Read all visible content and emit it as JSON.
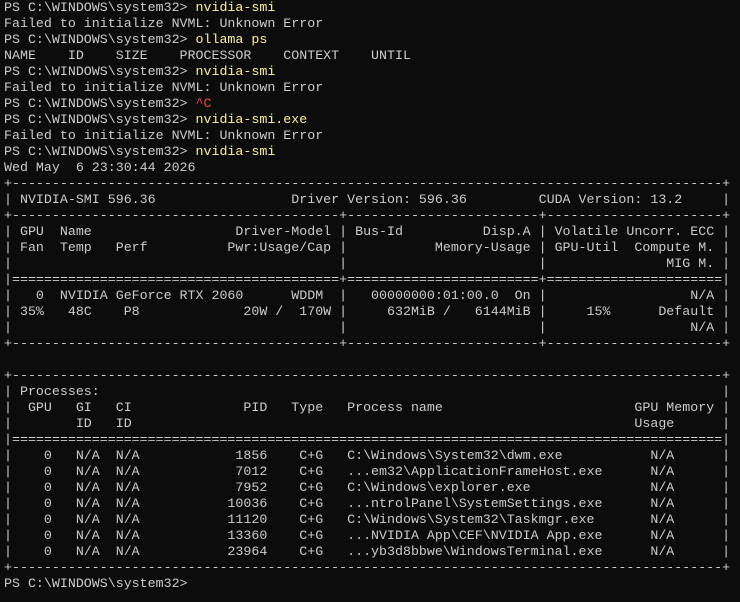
{
  "colors": {
    "background": "#0c0c0c",
    "text": "#cccccc",
    "command": "#f9f1a5",
    "interrupt": "#e74856"
  },
  "prompt": "PS C:\\WINDOWS\\system32> ",
  "history": [
    {
      "cmd": "nvidia-smi"
    },
    {
      "out": "Failed to initialize NVML: Unknown Error"
    },
    {
      "cmd": "ollama ps"
    },
    {
      "out": "NAME    ID    SIZE    PROCESSOR    CONTEXT    UNTIL"
    },
    {
      "cmd": "nvidia-smi"
    },
    {
      "out": "Failed to initialize NVML: Unknown Error"
    },
    {
      "ctrl": "^C"
    },
    {
      "cmd": "nvidia-smi.exe"
    },
    {
      "out": "Failed to initialize NVML: Unknown Error"
    },
    {
      "cmd": "nvidia-smi"
    }
  ],
  "smi": {
    "timestamp": "Wed May  6 23:30:44 2026",
    "table": [
      "+-----------------------------------------------------------------------------------------+",
      "| NVIDIA-SMI 596.36                 Driver Version: 596.36         CUDA Version: 13.2     |",
      "+-----------------------------------------+------------------------+----------------------+",
      "| GPU  Name                  Driver-Model | Bus-Id          Disp.A | Volatile Uncorr. ECC |",
      "| Fan  Temp   Perf          Pwr:Usage/Cap |           Memory-Usage | GPU-Util  Compute M. |",
      "|                                         |                        |               MIG M. |",
      "|=========================================+========================+======================|",
      "|   0  NVIDIA GeForce RTX 2060      WDDM  |   00000000:01:00.0  On |                  N/A |",
      "| 35%   48C    P8             20W /  170W |     632MiB /   6144MiB |     15%      Default |",
      "|                                         |                        |                  N/A |",
      "+-----------------------------------------+------------------------+----------------------+",
      "",
      "+-----------------------------------------------------------------------------------------+",
      "| Processes:                                                                              |",
      "|  GPU   GI   CI              PID   Type   Process name                        GPU Memory |",
      "|        ID   ID                                                               Usage      |",
      "|=========================================================================================|",
      "|    0   N/A  N/A            1856    C+G   C:\\Windows\\System32\\dwm.exe           N/A      |",
      "|    0   N/A  N/A            7012    C+G   ...em32\\ApplicationFrameHost.exe      N/A      |",
      "|    0   N/A  N/A            7952    C+G   C:\\Windows\\explorer.exe               N/A      |",
      "|    0   N/A  N/A           10036    C+G   ...ntrolPanel\\SystemSettings.exe      N/A      |",
      "|    0   N/A  N/A           11120    C+G   C:\\Windows\\System32\\Taskmgr.exe       N/A      |",
      "|    0   N/A  N/A           13360    C+G   ...NVIDIA App\\CEF\\NVIDIA App.exe      N/A      |",
      "|    0   N/A  N/A           23964    C+G   ...yb3d8bbwe\\WindowsTerminal.exe      N/A      |",
      "+-----------------------------------------------------------------------------------------+"
    ]
  },
  "final_prompt_cursor": ""
}
